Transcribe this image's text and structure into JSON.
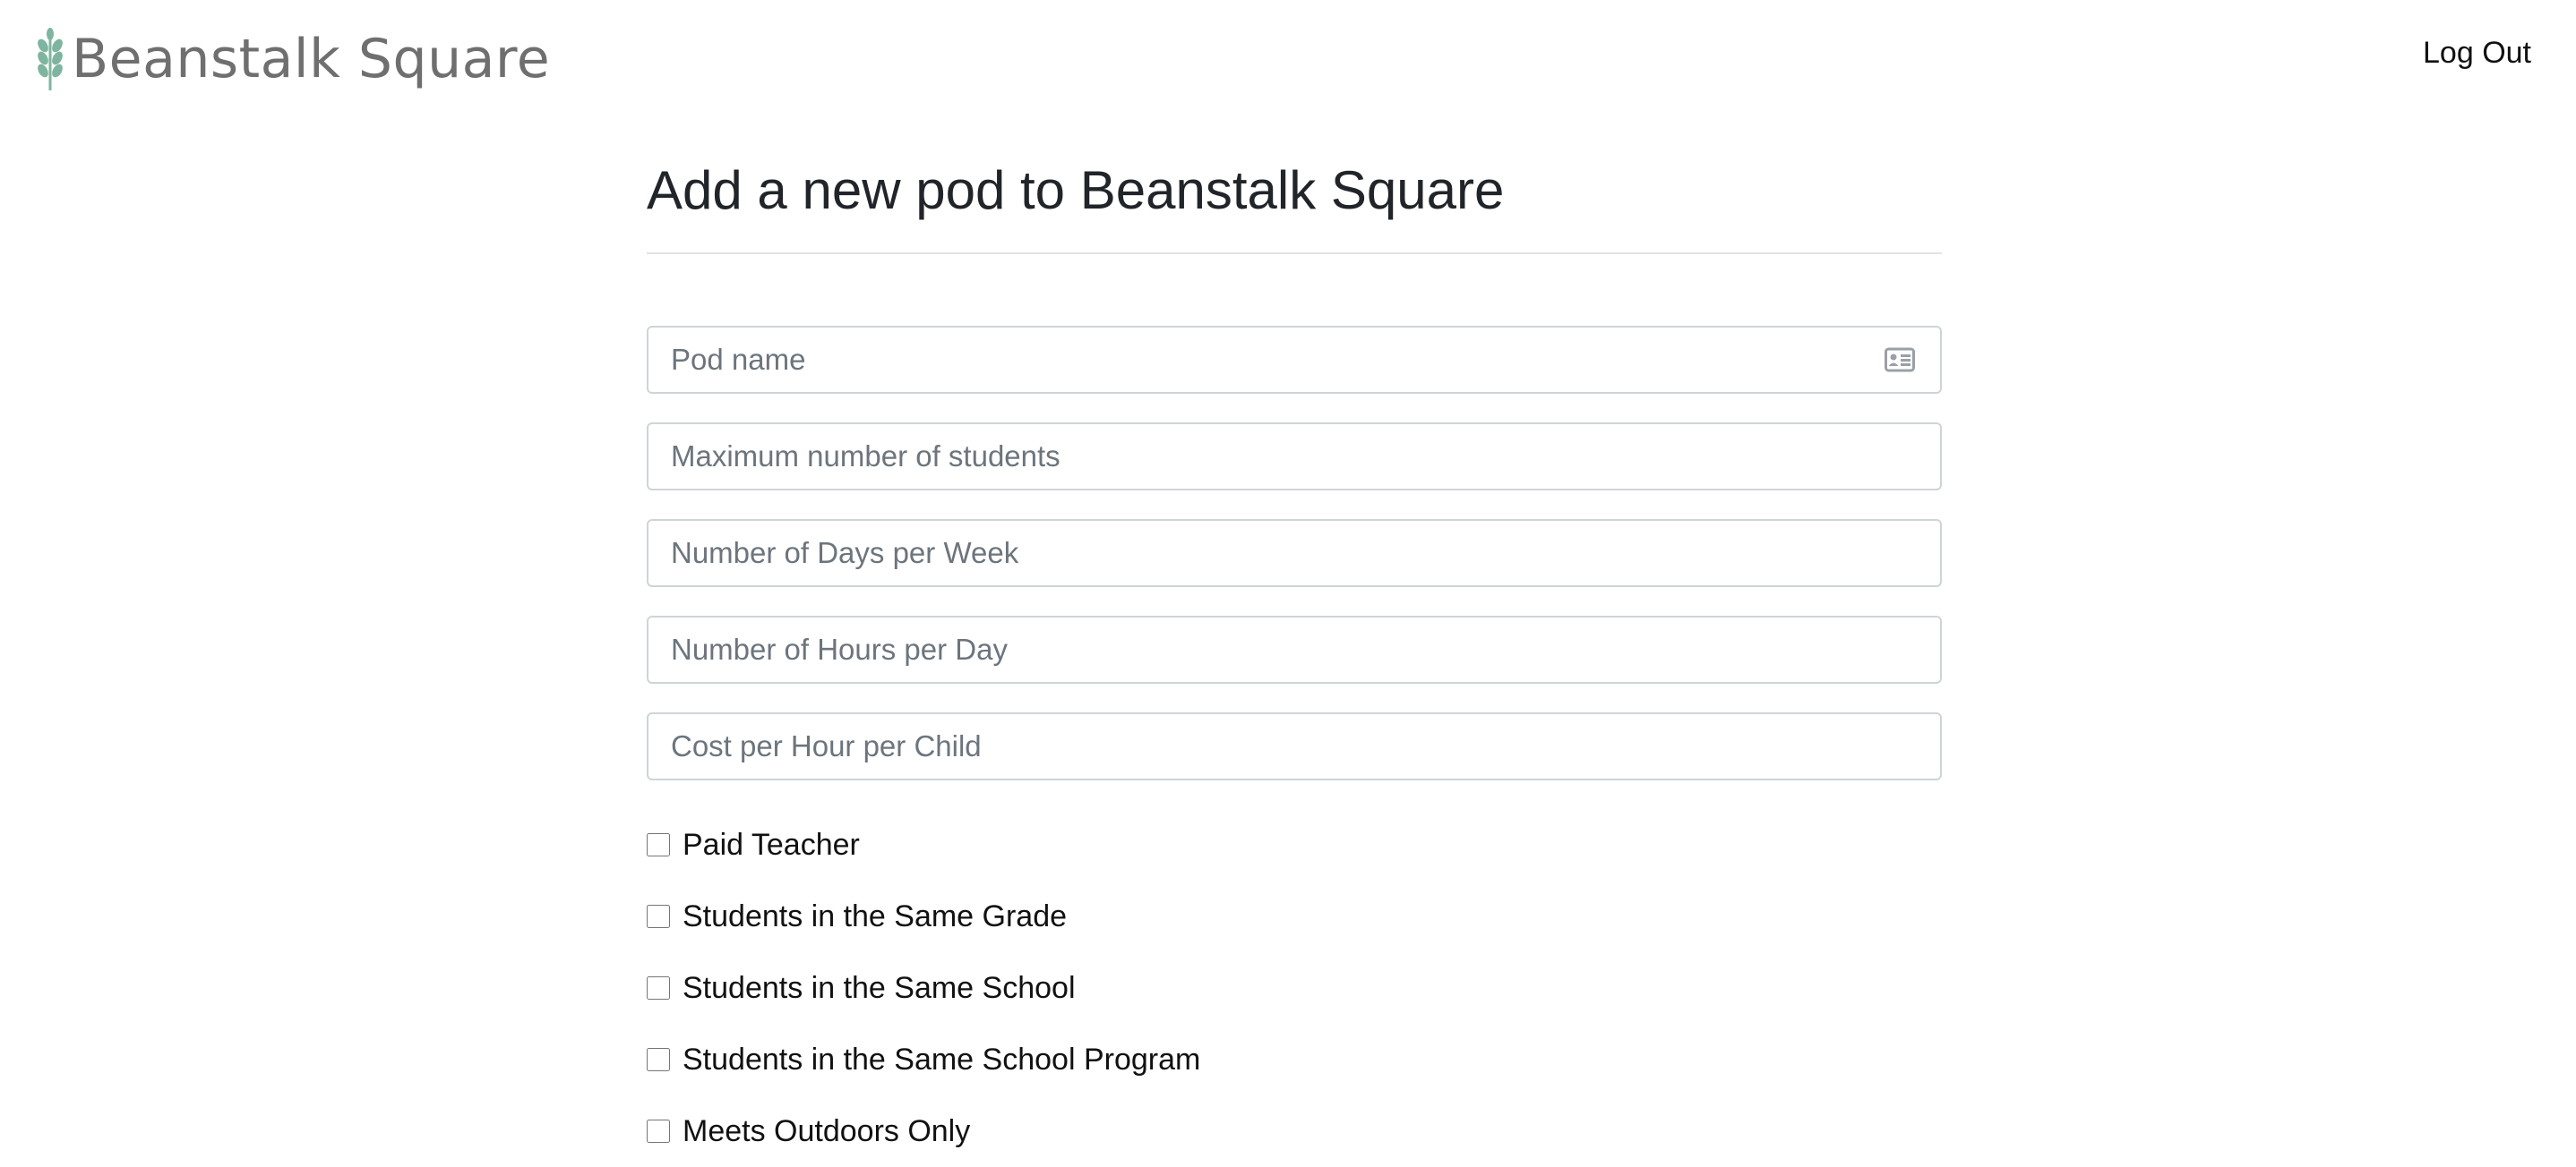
{
  "header": {
    "brand_name": "Beanstalk Square",
    "logout_label": "Log Out",
    "brand_color": "#7fb5a0"
  },
  "page": {
    "title": "Add a new pod to Beanstalk Square"
  },
  "form": {
    "fields": [
      {
        "placeholder": "Pod name",
        "icon": "id-card-icon"
      },
      {
        "placeholder": "Maximum number of students"
      },
      {
        "placeholder": "Number of Days per Week"
      },
      {
        "placeholder": "Number of Hours per Day"
      },
      {
        "placeholder": "Cost per Hour per Child"
      }
    ],
    "checkboxes": [
      {
        "label": "Paid Teacher",
        "checked": false
      },
      {
        "label": "Students in the Same Grade",
        "checked": false
      },
      {
        "label": "Students in the Same School",
        "checked": false
      },
      {
        "label": "Students in the Same School Program",
        "checked": false
      },
      {
        "label": "Meets Outdoors Only",
        "checked": false
      }
    ]
  }
}
